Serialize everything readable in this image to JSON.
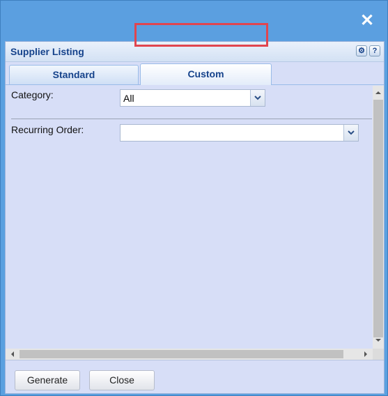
{
  "window": {
    "close_icon": "close-icon"
  },
  "panel": {
    "title": "Supplier Listing",
    "tools": [
      {
        "name": "gear-icon",
        "glyph": "⚙"
      },
      {
        "name": "help-icon",
        "glyph": "?"
      }
    ]
  },
  "tabs": [
    {
      "label": "Standard",
      "active": false
    },
    {
      "label": "Custom",
      "active": true
    }
  ],
  "highlight_color": "#e0454f",
  "form": {
    "category": {
      "label": "Category:",
      "value": "All"
    },
    "recurring_order": {
      "label": "Recurring Order:",
      "value": ""
    }
  },
  "footer": {
    "generate_label": "Generate",
    "close_label": "Close"
  },
  "colors": {
    "title_bar": "#5b9fe0",
    "panel_bg": "#d7def7",
    "title_text": "#15428b"
  }
}
